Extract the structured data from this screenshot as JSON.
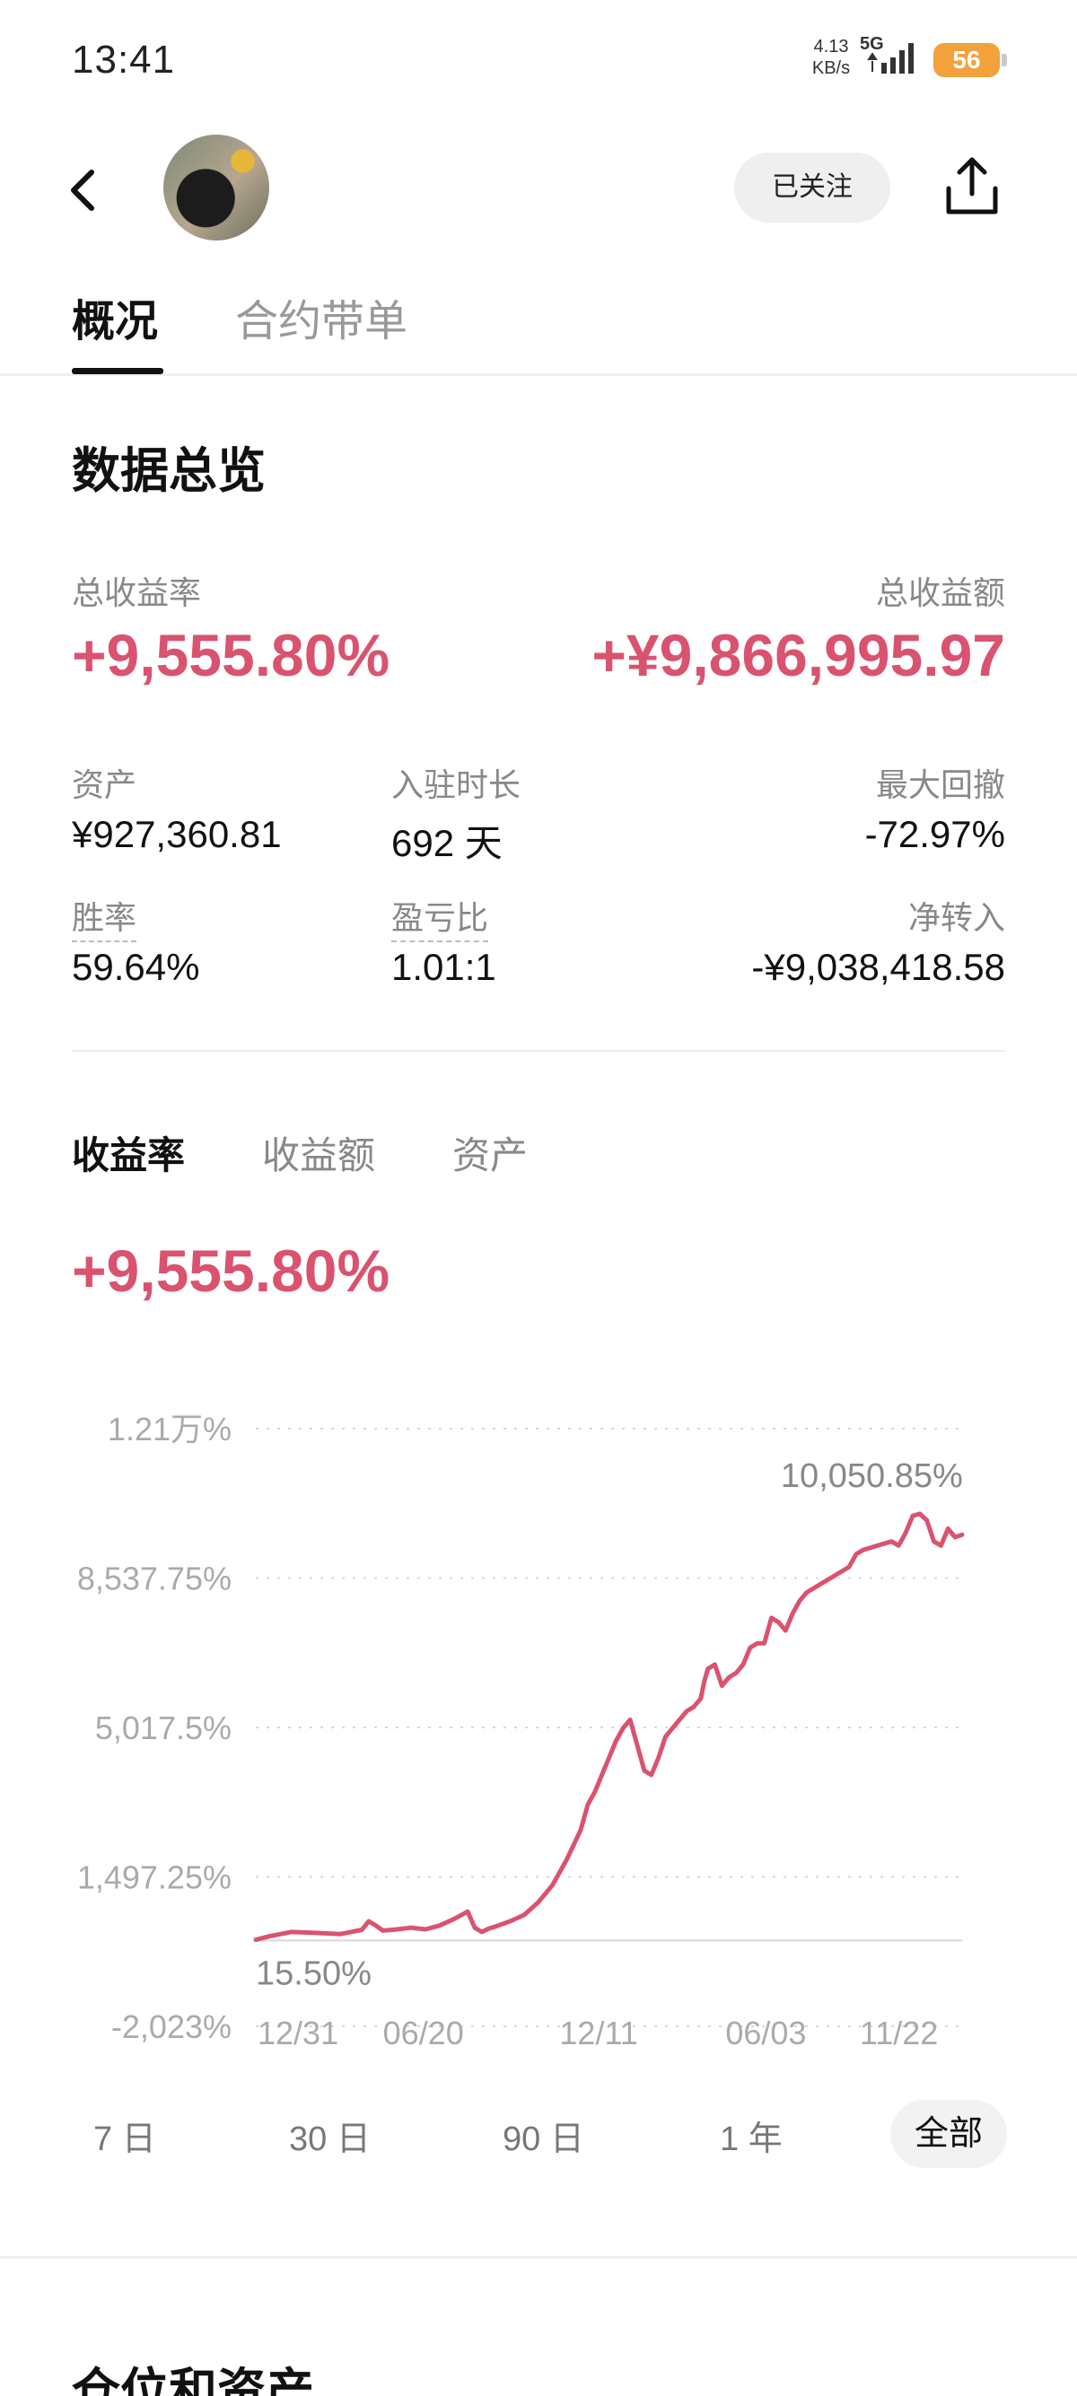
{
  "status_bar": {
    "time": "13:41",
    "net_speed_value": "4.13",
    "net_speed_unit": "KB/s",
    "net_type": "5G",
    "battery": "56"
  },
  "header": {
    "follow_label": "已关注"
  },
  "tabs": [
    {
      "label": "概况",
      "active": true
    },
    {
      "label": "合约带单",
      "active": false
    }
  ],
  "overview": {
    "title": "数据总览",
    "total_return_rate_label": "总收益率",
    "total_return_rate": "+9,555.80%",
    "total_return_amount_label": "总收益额",
    "total_return_amount": "+¥9,866,995.97",
    "assets_label": "资产",
    "assets": "¥927,360.81",
    "tenure_label": "入驻时长",
    "tenure": "692 天",
    "max_drawdown_label": "最大回撤",
    "max_drawdown": "-72.97%",
    "win_rate_label": "胜率",
    "win_rate": "59.64%",
    "pl_ratio_label": "盈亏比",
    "pl_ratio": "1.01:1",
    "net_transfer_label": "净转入",
    "net_transfer": "-¥9,038,418.58"
  },
  "chart_section": {
    "subtabs": [
      {
        "label": "收益率",
        "active": true
      },
      {
        "label": "收益额",
        "active": false
      },
      {
        "label": "资产",
        "active": false
      }
    ],
    "current_value": "+9,555.80%",
    "periods": [
      {
        "label": "7 日",
        "active": false
      },
      {
        "label": "30 日",
        "active": false
      },
      {
        "label": "90 日",
        "active": false
      },
      {
        "label": "1 年",
        "active": false
      },
      {
        "label": "全部",
        "active": true
      }
    ]
  },
  "chart_data": {
    "type": "line",
    "title": "",
    "xlabel": "",
    "ylabel": "",
    "series": [
      {
        "color": "#d9536f",
        "x": [
          0,
          0.02,
          0.05,
          0.08,
          0.12,
          0.15,
          0.16,
          0.17,
          0.18,
          0.2,
          0.22,
          0.24,
          0.26,
          0.28,
          0.3,
          0.31,
          0.32,
          0.33,
          0.34,
          0.36,
          0.38,
          0.4,
          0.42,
          0.44,
          0.46,
          0.47,
          0.48,
          0.49,
          0.5,
          0.51,
          0.52,
          0.53,
          0.54,
          0.55,
          0.56,
          0.57,
          0.58,
          0.59,
          0.6,
          0.61,
          0.62,
          0.63,
          0.635,
          0.64,
          0.65,
          0.66,
          0.67,
          0.68,
          0.69,
          0.7,
          0.71,
          0.72,
          0.73,
          0.74,
          0.75,
          0.76,
          0.77,
          0.78,
          0.8,
          0.82,
          0.84,
          0.85,
          0.86,
          0.88,
          0.9,
          0.91,
          0.92,
          0.93,
          0.94,
          0.95,
          0.96,
          0.97,
          0.98,
          0.99,
          1.0
        ],
        "values": [
          15.5,
          100,
          200,
          180,
          150,
          250,
          450,
          350,
          230,
          260,
          300,
          260,
          350,
          500,
          680,
          300,
          200,
          280,
          330,
          450,
          600,
          900,
          1300,
          1900,
          2600,
          3200,
          3500,
          3900,
          4300,
          4700,
          5000,
          5200,
          4600,
          4000,
          3900,
          4300,
          4800,
          5000,
          5200,
          5400,
          5500,
          5700,
          6100,
          6400,
          6500,
          6000,
          6200,
          6300,
          6500,
          6900,
          7000,
          7000,
          7600,
          7500,
          7300,
          7700,
          8000,
          8200,
          8400,
          8600,
          8800,
          9100,
          9200,
          9300,
          9400,
          9300,
          9600,
          10000,
          10050.85,
          9900,
          9400,
          9300,
          9700,
          9500,
          9555.8
        ]
      }
    ],
    "x_tick_labels": [
      "12/31",
      "06/20",
      "12/11",
      "06/03",
      "11/22"
    ],
    "y_tick_labels": [
      "1.21万%",
      "8,537.75%",
      "5,017.5%",
      "1,497.25%",
      "-2,023%"
    ],
    "y_ticks": [
      12058,
      8537.75,
      5017.5,
      1497.25,
      -2023
    ],
    "ylim": [
      -2023,
      12058
    ],
    "annotations": [
      {
        "label": "10,050.85%",
        "x": 0.94,
        "y": 10050.85,
        "position": "above"
      },
      {
        "label": "15.50%",
        "x": 0,
        "y": 15.5,
        "position": "below"
      }
    ],
    "grid": true,
    "baseline_value": 0
  },
  "positions_section": {
    "title": "仓位和资产"
  }
}
